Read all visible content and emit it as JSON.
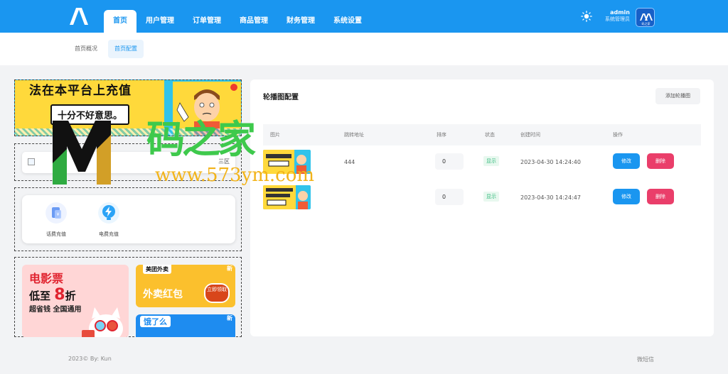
{
  "header": {
    "nav": [
      "首页",
      "用户管理",
      "订单管理",
      "商品管理",
      "财务管理",
      "系统设置"
    ],
    "active_nav": "首页",
    "user_name": "admin",
    "user_role": "系统管理员",
    "avatar_text": "码之家"
  },
  "subnav": {
    "tabs": [
      "首页概况",
      "首页配置"
    ],
    "active": "首页配置"
  },
  "preview": {
    "banner_line1": "法在本平台上充值",
    "banner_line2": "十分不好意思。",
    "notice_end": "三区",
    "recharge": [
      "话费充值",
      "电费充值"
    ],
    "movie_title": "电影票",
    "movie_prefix": "低至",
    "movie_discount": "8",
    "movie_suffix": "折",
    "movie_sub": "超省钱 全国通用",
    "food_brand": "美团外卖",
    "food_title": "外卖红包",
    "food_button": "立即领取",
    "food_new": "新",
    "ele_brand": "饿了么",
    "ele_new": "新"
  },
  "panel": {
    "title": "轮播图配置",
    "add_button": "添加轮播图",
    "columns": [
      "图片",
      "跳转地址",
      "排序",
      "状态",
      "创建时间",
      "操作"
    ],
    "rows": [
      {
        "link": "444",
        "sort": "0",
        "status": "显示",
        "created": "2023-04-30 14:24:40",
        "edit": "修改",
        "delete": "删除"
      },
      {
        "link": "",
        "sort": "0",
        "status": "显示",
        "created": "2023-04-30 14:24:47",
        "edit": "修改",
        "delete": "删除"
      }
    ]
  },
  "footer": {
    "copyright": "2023© By: Kun",
    "right_link": "微短信"
  },
  "watermark": {
    "text": "码之家",
    "url": "www.573ym.com"
  },
  "colors": {
    "primary": "#1a96f0",
    "danger": "#ea3e6a",
    "success": "#2fb87a",
    "background": "#f2f3f5"
  }
}
